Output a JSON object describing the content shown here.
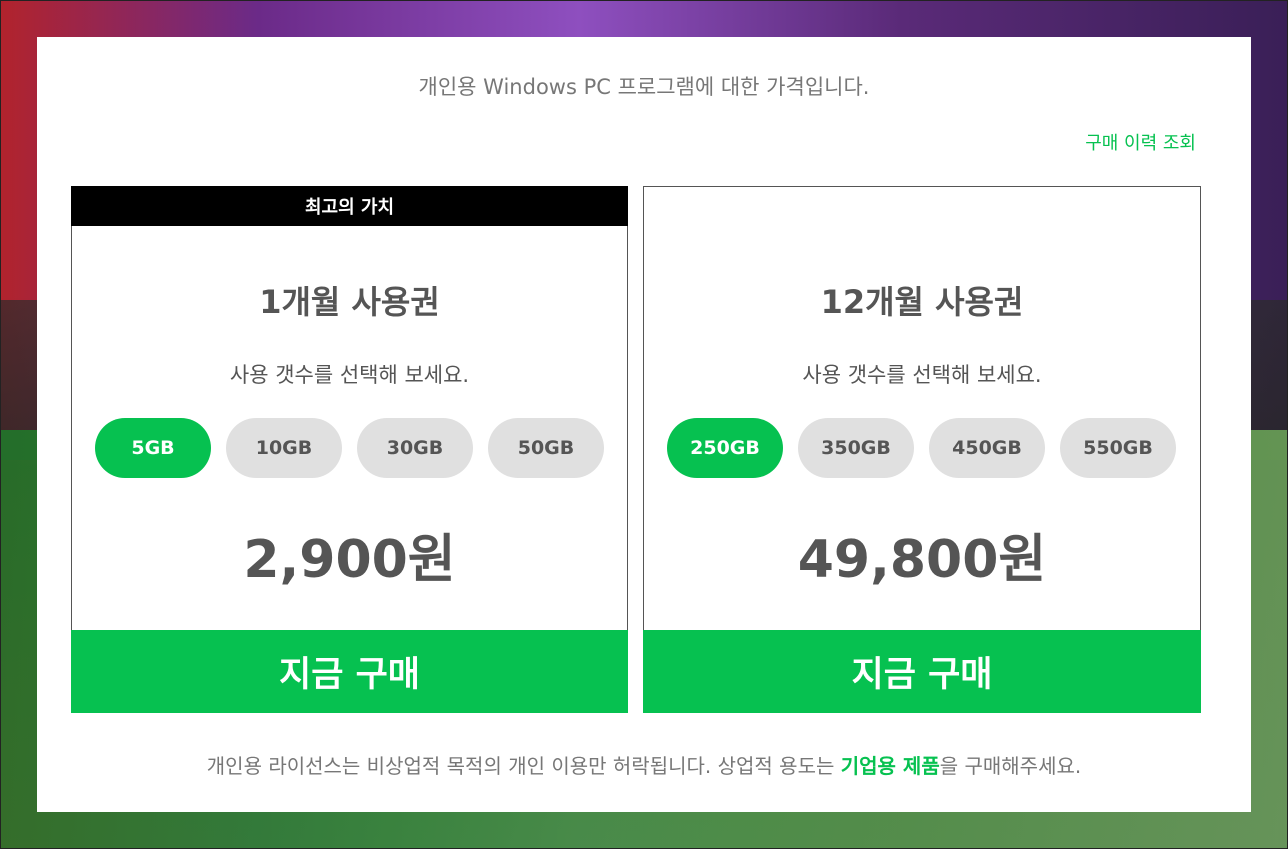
{
  "intro": "개인용 Windows PC 프로그램에 대한 가격입니다.",
  "history_link": "구매 이력 조회",
  "plans": [
    {
      "ribbon": "최고의 가치",
      "title": "1개월 사용권",
      "subtitle": "사용 갯수를 선택해 보세요.",
      "options": [
        "5GB",
        "10GB",
        "30GB",
        "50GB"
      ],
      "selected": "5GB",
      "price": "2,900원",
      "buy_label": "지금 구매"
    },
    {
      "title": "12개월 사용권",
      "subtitle": "사용 갯수를 선택해 보세요.",
      "options": [
        "250GB",
        "350GB",
        "450GB",
        "550GB"
      ],
      "selected": "250GB",
      "price": "49,800원",
      "buy_label": "지금 구매"
    }
  ],
  "note": {
    "prefix": "개인용 라이선스는 비상업적 목적의 개인 이용만 허락됩니다. 상업적 용도는 ",
    "link": "기업용 제품",
    "suffix": "을 구매해주세요."
  },
  "colors": {
    "accent": "#06c150",
    "text": "#555555",
    "muted": "#777777",
    "ribbon": "#000000"
  }
}
